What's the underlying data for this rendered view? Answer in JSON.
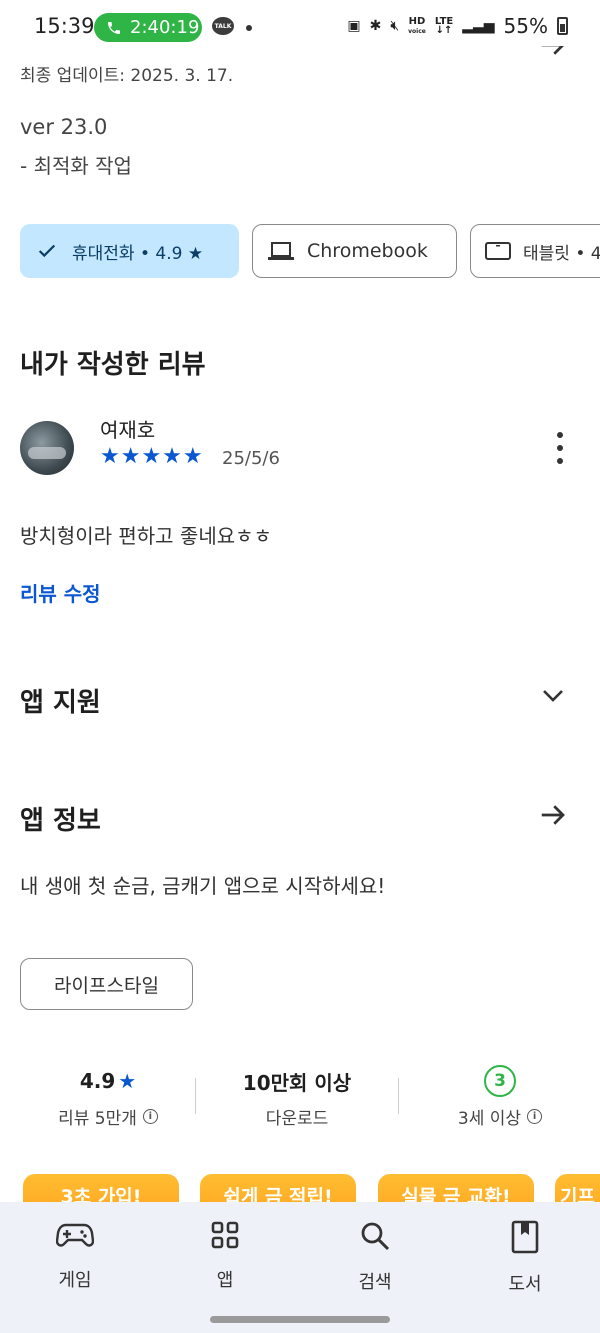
{
  "status_bar": {
    "time": "15:39",
    "call_timer": "2:40:19",
    "talk_badge": "TALK",
    "hd_label": "HD",
    "voice_label": "voice",
    "lte_label": "LTE",
    "battery": "55%"
  },
  "whats_new": {
    "updated_label": "최종 업데이트: 2025. 3. 17.",
    "version": "ver 23.0",
    "note": "- 최적화 작업"
  },
  "device_chips": [
    {
      "label": "휴대전화 • 4.9 ★",
      "selected": true
    },
    {
      "label": "Chromebook",
      "selected": false
    },
    {
      "label": "태블릿 • 4",
      "selected": false
    }
  ],
  "my_review": {
    "section_title": "내가 작성한 리뷰",
    "reviewer": "여재호",
    "stars": "★★★★★",
    "rating": 5,
    "date": "25/5/6",
    "text": "방치형이라 편하고 좋네요ㅎㅎ",
    "edit_label": "리뷰 수정"
  },
  "app_support": {
    "title": "앱 지원"
  },
  "app_info": {
    "title": "앱 정보",
    "description": "내 생애 첫 순금, 금캐기 앱으로 시작하세요!",
    "tag": "라이프스타일"
  },
  "stats": {
    "rating_value": "4.9",
    "rating_star": "★",
    "rating_label": "리뷰 5만개",
    "downloads_value": "10만회 이상",
    "downloads_label": "다운로드",
    "age_badge": "3",
    "age_label": "3세 이상"
  },
  "promos": [
    "3초 가입!",
    "쉽게 금 적립!",
    "실물 금 교환!",
    "기프"
  ],
  "bottom_nav": [
    {
      "label": "게임",
      "icon": "gamepad-icon"
    },
    {
      "label": "앱",
      "icon": "apps-grid-icon"
    },
    {
      "label": "검색",
      "icon": "search-icon"
    },
    {
      "label": "도서",
      "icon": "book-icon"
    }
  ],
  "colors": {
    "accent": "#0b57d0",
    "chip_selected": "#c2e7ff",
    "call_green": "#2fb545",
    "promo_orange": "#ff9c1a",
    "nav_bg": "#eef2f8"
  }
}
